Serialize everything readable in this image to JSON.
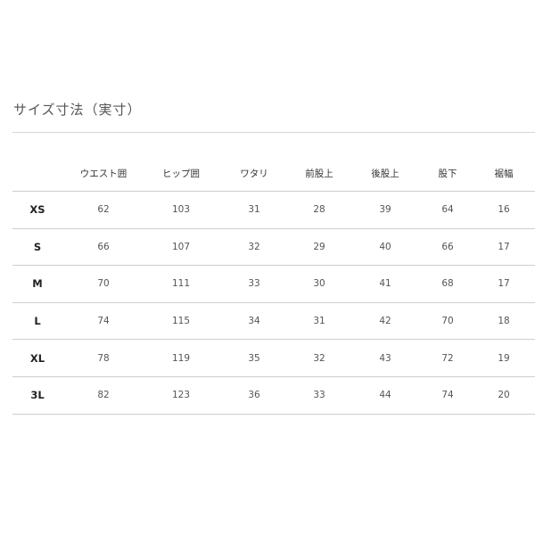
{
  "title": "サイズ寸法（実寸）",
  "headers": [
    "",
    "ウエスト囲",
    "ヒップ囲",
    "ワタリ",
    "前股上",
    "後股上",
    "股下",
    "裾幅"
  ],
  "rows": [
    {
      "size": "XS",
      "values": [
        "62",
        "103",
        "31",
        "28",
        "39",
        "64",
        "16"
      ]
    },
    {
      "size": "S",
      "values": [
        "66",
        "107",
        "32",
        "29",
        "40",
        "66",
        "17"
      ]
    },
    {
      "size": "M",
      "values": [
        "70",
        "111",
        "33",
        "30",
        "41",
        "68",
        "17"
      ]
    },
    {
      "size": "L",
      "values": [
        "74",
        "115",
        "34",
        "31",
        "42",
        "70",
        "18"
      ]
    },
    {
      "size": "XL",
      "values": [
        "78",
        "119",
        "35",
        "32",
        "43",
        "72",
        "19"
      ]
    },
    {
      "size": "3L",
      "values": [
        "82",
        "123",
        "36",
        "33",
        "44",
        "74",
        "20"
      ]
    }
  ]
}
